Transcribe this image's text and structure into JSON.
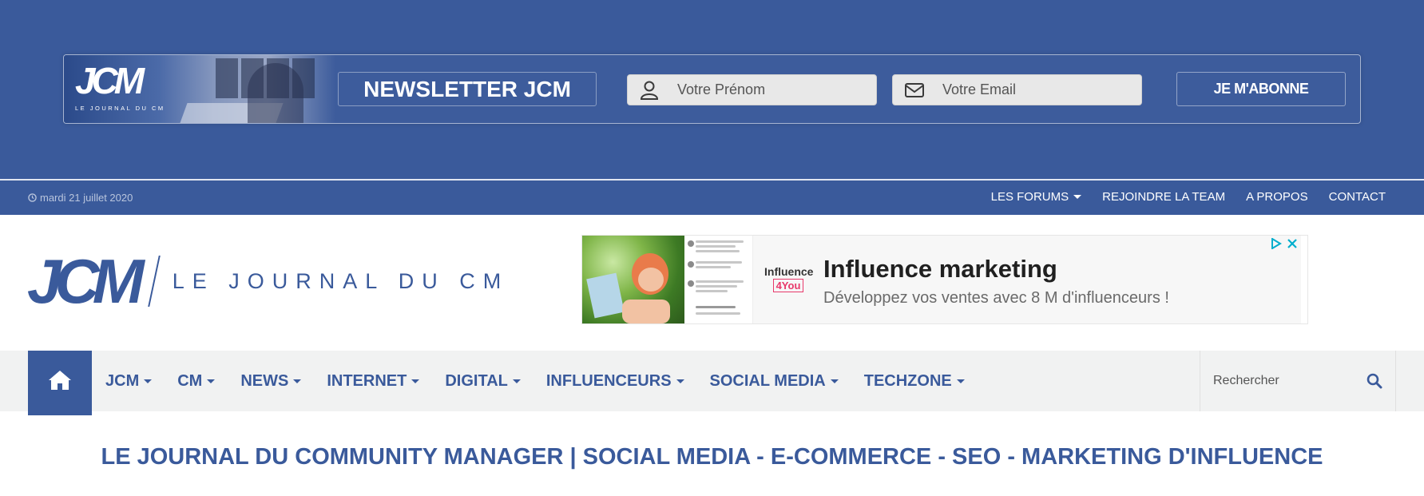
{
  "newsletter": {
    "logo_text": "JCM",
    "logo_sub": "LE JOURNAL DU CM",
    "title": "NEWSLETTER JCM",
    "firstname_placeholder": "Votre Prénom",
    "email_placeholder": "Votre Email",
    "subscribe_label": "JE M'ABONNE"
  },
  "topbar": {
    "date": "mardi 21 juillet 2020",
    "links": [
      {
        "label": "LES FORUMS",
        "dropdown": true
      },
      {
        "label": "REJOINDRE LA TEAM"
      },
      {
        "label": "A PROPOS"
      },
      {
        "label": "CONTACT"
      }
    ]
  },
  "header": {
    "logo_text": "JCM",
    "tagline": "LE JOURNAL DU CM"
  },
  "ad": {
    "brand_line1": "Influence",
    "brand_line2": "4You",
    "headline": "Influence marketing",
    "description": "Développez vos ventes avec 8 M d'influenceurs !"
  },
  "nav": {
    "items": [
      {
        "label": "JCM"
      },
      {
        "label": "CM"
      },
      {
        "label": "NEWS"
      },
      {
        "label": "INTERNET"
      },
      {
        "label": "DIGITAL"
      },
      {
        "label": "INFLUENCEURS"
      },
      {
        "label": "SOCIAL MEDIA"
      },
      {
        "label": "TECHZONE"
      }
    ],
    "search_placeholder": "Rechercher"
  },
  "site_title": "LE JOURNAL DU COMMUNITY MANAGER | SOCIAL MEDIA - E-COMMERCE - SEO - MARKETING D'INFLUENCE",
  "colors": {
    "brand_blue": "#3a5a9b",
    "nav_bg": "#f1f2f2",
    "ad_button": "#333333",
    "ad_pink": "#e8396b"
  }
}
